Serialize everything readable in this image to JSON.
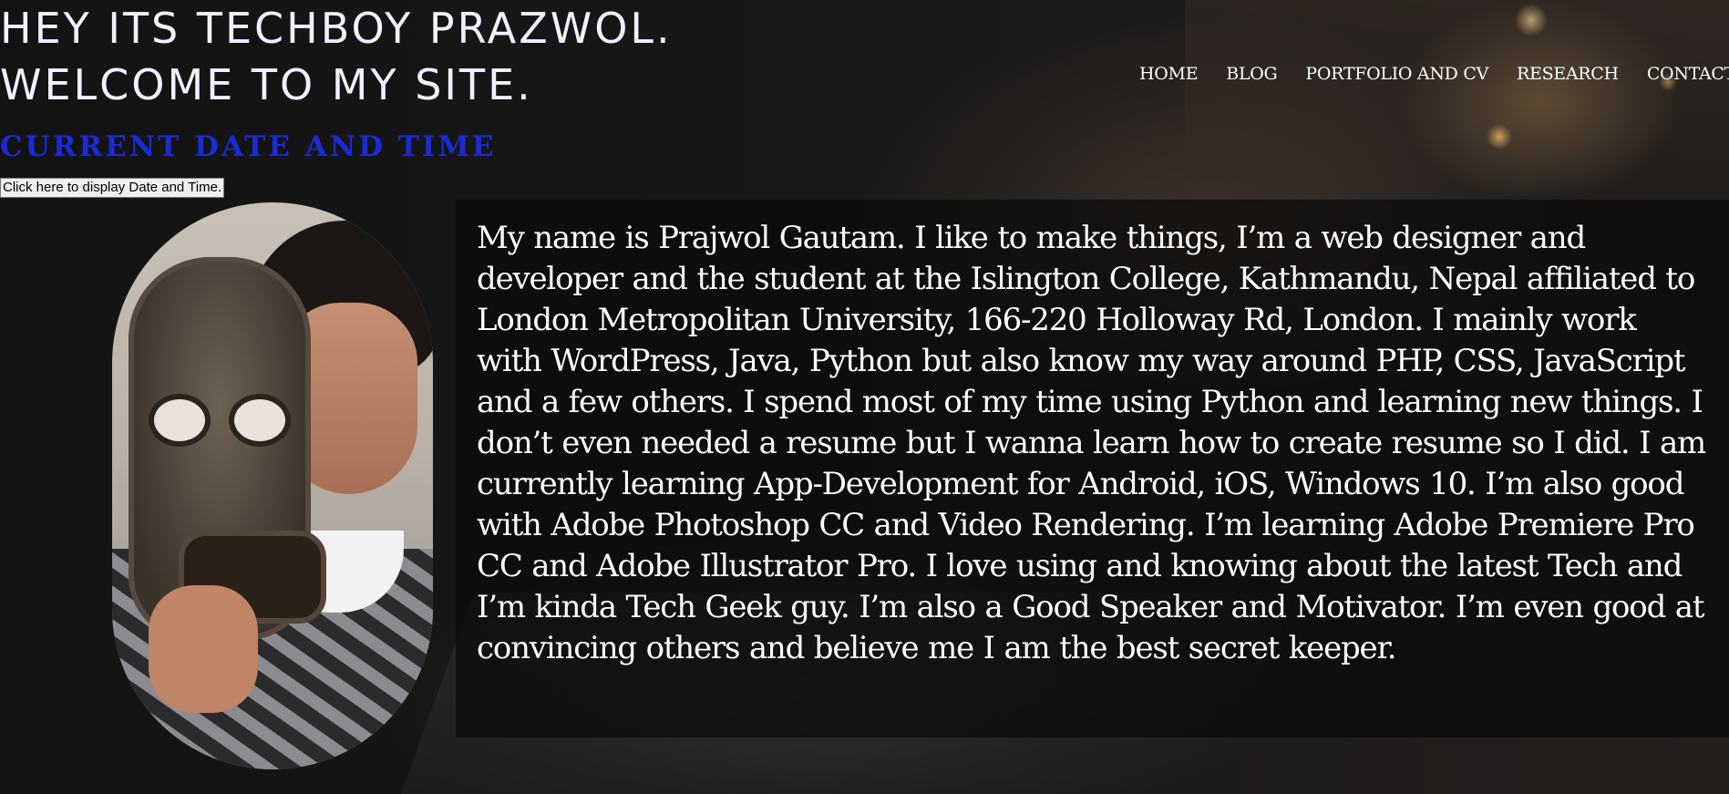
{
  "header": {
    "title_line1": "HEY ITS TECHBOY PRAZWOL.",
    "title_line2": "WELCOME TO MY SITE."
  },
  "nav": {
    "items": [
      "HOME",
      "BLOG",
      "PORTFOLIO AND CV",
      "RESEARCH",
      "CONTACT"
    ]
  },
  "datetime": {
    "heading": "CURRENT DATE AND TIME",
    "button_label": "Click here to display Date and Time."
  },
  "bio": {
    "text": "My name is Prajwol Gautam. I like to make things, I’m a web designer and developer and the student at the Islington College, Kathmandu, Nepal affiliated to London Metropolitan University, 166-220 Holloway Rd, London. I mainly work with WordPress, Java, Python but also know my way around PHP, CSS, JavaScript and a few others. I spend most of my time using Python and learning new things. I don’t even needed a resume but I wanna learn how to create resume so I did. I am currently learning App-Development for Android, iOS, Windows 10. I’m also good with Adobe Photoshop CC and Video Rendering. I’m learning Adobe Premiere Pro CC and Adobe Illustrator Pro. I love using and knowing about the latest Tech and I’m kinda Tech Geek guy. I’m also a Good Speaker and Motivator. I’m even good at convincing others and believe me I am the best secret keeper."
  },
  "colors": {
    "heading_accent": "#1b2bd6",
    "title_text": "#f4f0ff",
    "background": "#151515"
  }
}
